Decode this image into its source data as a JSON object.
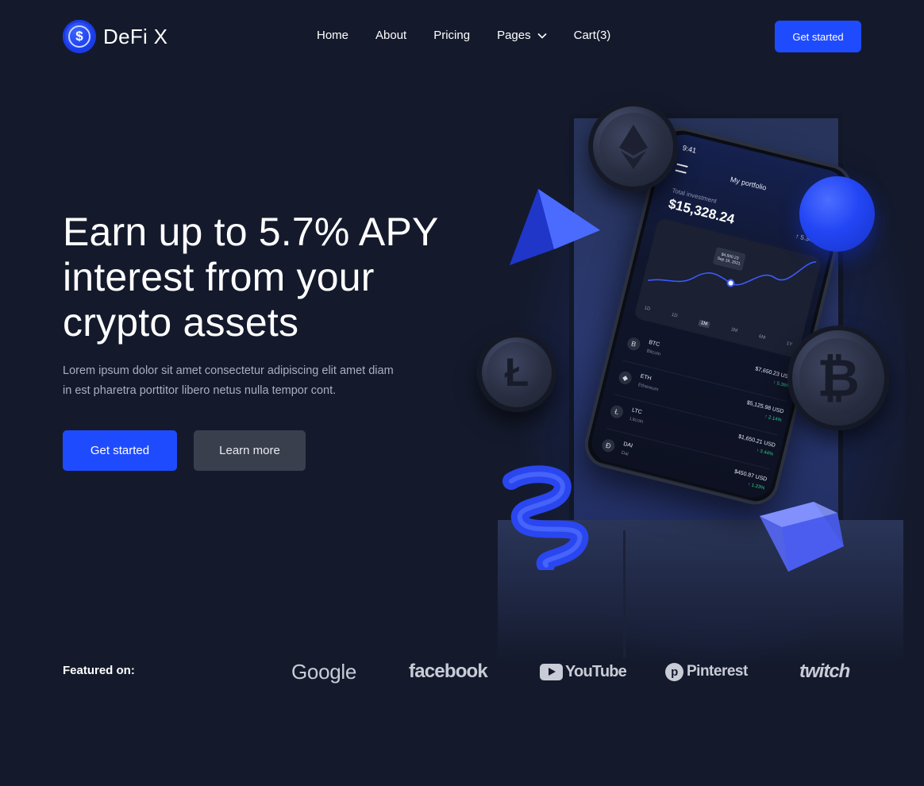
{
  "brand": {
    "name": "DeFi X",
    "logo_symbol": "$"
  },
  "nav": {
    "items": [
      {
        "label": "Home"
      },
      {
        "label": "About"
      },
      {
        "label": "Pricing"
      },
      {
        "label": "Pages"
      },
      {
        "label": "Cart(3)"
      }
    ],
    "cta": "Get started"
  },
  "hero": {
    "title_lines": [
      "Earn up to 5.7% APY",
      "interest from your",
      "crypto assets"
    ],
    "subtitle_lines": [
      "Lorem ipsum dolor sit amet consectetur adipiscing elit amet diam",
      "in est pharetra porttitor libero netus nulla tempor cont."
    ],
    "primary_button": "Get started",
    "secondary_button": "Learn more"
  },
  "phone": {
    "time": "9:41",
    "title": "My portfolio",
    "total_label": "Total investment",
    "total_value": "$15,328.24",
    "total_change": "↑ 5.34%",
    "tooltip_value": "$4,500.23",
    "tooltip_date": "Sep 19, 2021",
    "ranges": [
      "1D",
      "1D",
      "1M",
      "3M",
      "6M",
      "1Y"
    ],
    "active_range": "1M",
    "assets": [
      {
        "symbol": "BTC",
        "name": "Bitcoin",
        "value": "$7,650.23 USD",
        "change": "↑ 5.36%",
        "icon": "B"
      },
      {
        "symbol": "ETH",
        "name": "Ethereum",
        "value": "$5,125.98 USD",
        "change": "↑ 2.14%",
        "icon": "◆"
      },
      {
        "symbol": "LTC",
        "name": "Litcoin",
        "value": "$1,650.21 USD",
        "change": "↑ 3.44%",
        "icon": "Ł"
      },
      {
        "symbol": "DAI",
        "name": "Dai",
        "value": "$450.87 USD",
        "change": "↑ 1.23%",
        "icon": "Ð"
      }
    ]
  },
  "featured": {
    "label": "Featured on:",
    "brands": [
      {
        "name": "Google",
        "icon": "google-logo"
      },
      {
        "name": "facebook",
        "icon": "facebook-logo"
      },
      {
        "name": "YouTube",
        "icon": "youtube-logo"
      },
      {
        "name": "Pinterest",
        "icon": "pinterest-logo"
      },
      {
        "name": "twitch",
        "icon": "twitch-logo"
      }
    ]
  },
  "colors": {
    "background": "#141a2c",
    "accent": "#1f4bff",
    "secondary_button": "#3a3f4e",
    "muted_text": "#a9afc2"
  }
}
